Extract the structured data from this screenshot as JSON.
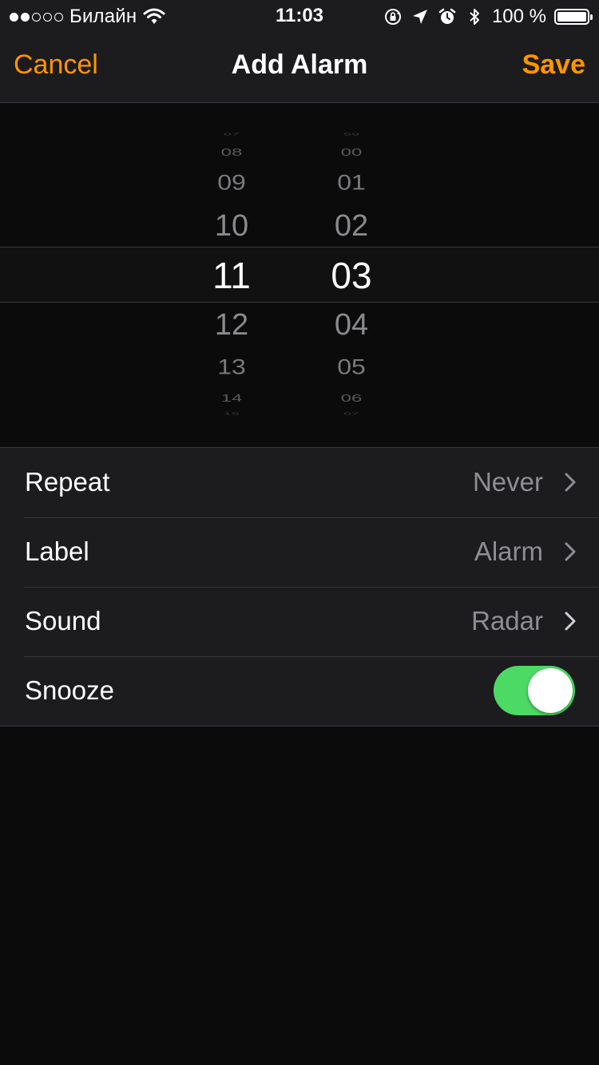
{
  "status_bar": {
    "carrier": "Билайн",
    "time": "11:03",
    "battery_percent": "100 %",
    "signal_bars_filled": 2,
    "signal_bars_total": 5,
    "icons": [
      "wifi-icon",
      "orientation-lock-icon",
      "location-arrow-icon",
      "alarm-clock-icon",
      "bluetooth-icon",
      "battery-icon"
    ]
  },
  "nav": {
    "cancel_label": "Cancel",
    "title": "Add Alarm",
    "save_label": "Save",
    "accent_color": "#ff9500"
  },
  "picker": {
    "hours": {
      "edge_top": "07",
      "above": [
        "08",
        "09",
        "10"
      ],
      "selected": "11",
      "below": [
        "12",
        "13",
        "14"
      ],
      "edge_bottom": "15"
    },
    "minutes": {
      "edge_top": "59",
      "above": [
        "00",
        "01",
        "02"
      ],
      "selected": "03",
      "below": [
        "04",
        "05",
        "06"
      ],
      "edge_bottom": "07"
    }
  },
  "settings": {
    "repeat": {
      "label": "Repeat",
      "value": "Never"
    },
    "label": {
      "label": "Label",
      "value": "Alarm"
    },
    "sound": {
      "label": "Sound",
      "value": "Radar"
    },
    "snooze": {
      "label": "Snooze",
      "enabled": true,
      "on_color": "#4cd964"
    }
  }
}
